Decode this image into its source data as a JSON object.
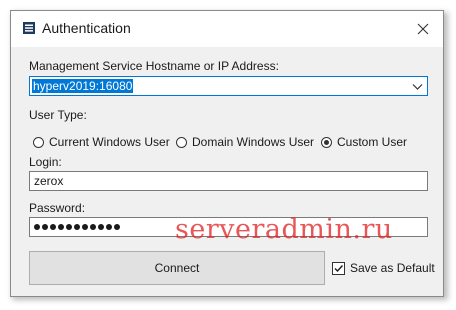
{
  "window": {
    "title": "Authentication",
    "close_glyph": "✕"
  },
  "host": {
    "label": "Management Service Hostname or IP Address:",
    "value": "hyperv2019:16080"
  },
  "user_type": {
    "label": "User Type:",
    "options": [
      {
        "label": "Current Windows User",
        "selected": false
      },
      {
        "label": "Domain Windows User",
        "selected": false
      },
      {
        "label": "Custom User",
        "selected": true
      }
    ]
  },
  "login": {
    "label": "Login:",
    "value": "zerox"
  },
  "password": {
    "label": "Password:",
    "mask_length": 11
  },
  "actions": {
    "connect_label": "Connect",
    "save_default_label": "Save as Default",
    "save_default_checked": true
  },
  "watermark": "serveradmin.ru",
  "colors": {
    "accent": "#0078d7",
    "watermark": "#e02020"
  }
}
